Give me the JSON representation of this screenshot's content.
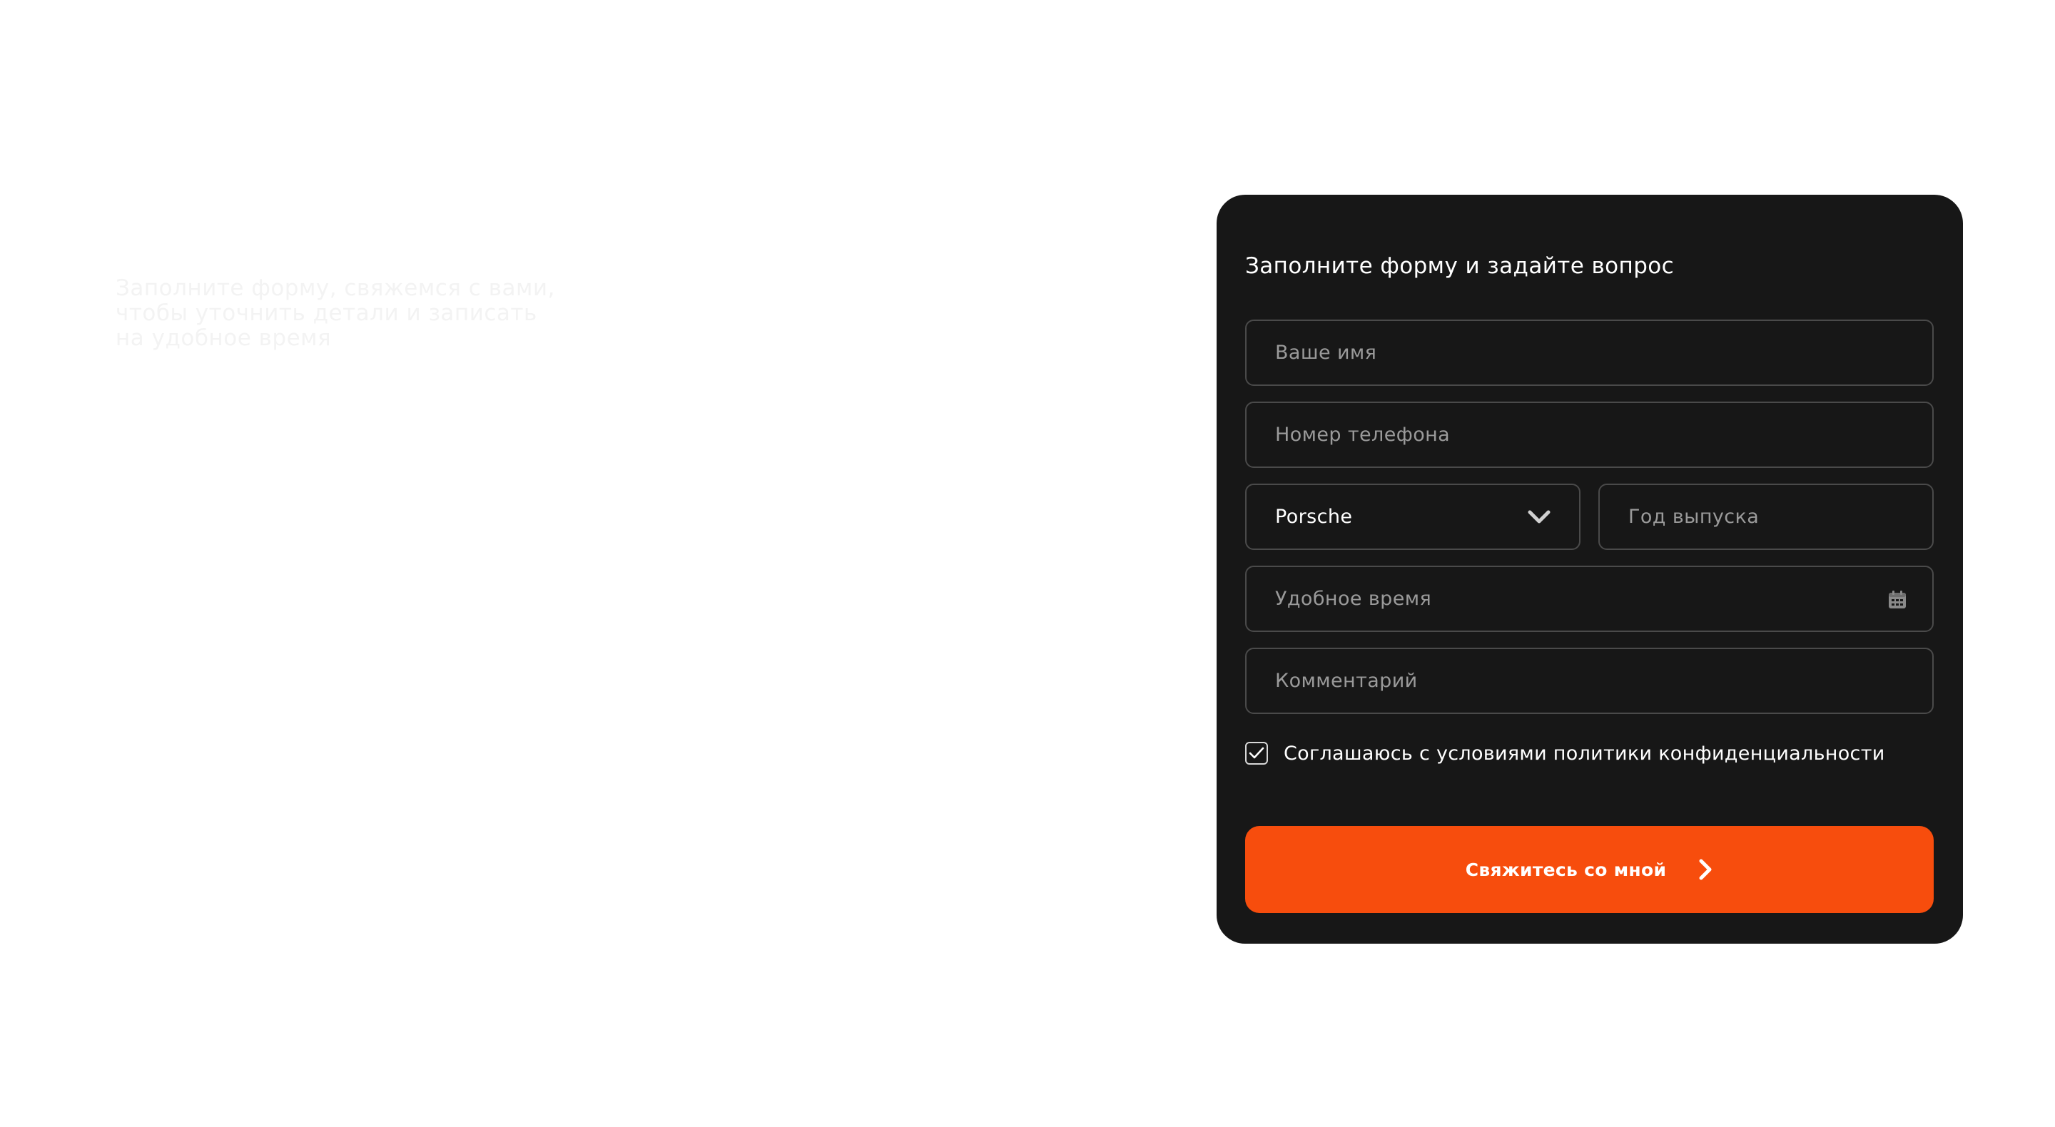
{
  "intro": {
    "lines": [
      "Заполните форму, свяжемся с вами,",
      "чтобы уточнить детали и записать",
      "на удобное время"
    ]
  },
  "form": {
    "title": "Заполните форму и задайте вопрос",
    "name_placeholder": "Ваше имя",
    "phone_placeholder": "Номер телефона",
    "brand_value": "Porsche",
    "brand_icon": "chevron-down-icon",
    "year_placeholder": "Год выпуска",
    "time_placeholder": "Удобное время",
    "time_icon": "calendar-icon",
    "comment_placeholder": "Комментарий",
    "consent_label": "Соглашаюсь с условиями политики конфиденциальности",
    "consent_checked": true,
    "submit_label": "Свяжитесь со мной",
    "submit_icon": "chevron-right-icon"
  },
  "colors": {
    "page_background": "#ffffff",
    "card_background": "#171717",
    "accent": "#f74d0d",
    "field_border": "#4a4a4a",
    "placeholder": "#9a9a9a",
    "text": "#ffffff"
  }
}
